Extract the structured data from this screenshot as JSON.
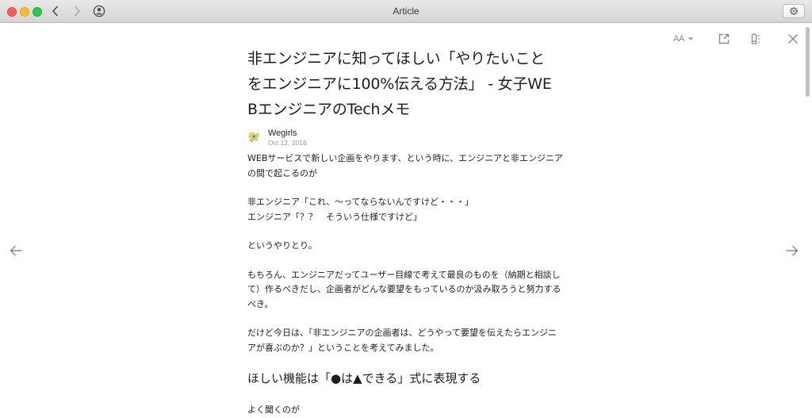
{
  "window": {
    "title": "Article"
  },
  "article": {
    "title": "非エンジニアに知ってほしい「やりたいこと\nをエンジニアに100%伝える方法」 - 女子WE\nBエンジニアのTechメモ",
    "author": "Wegirls",
    "date": "Oct 12, 2016",
    "paragraphs": [
      "WEBサービスで新しい企画をやります、という時に、エンジニアと非エンジニア\nの間で起こるのが",
      "非エンジニア「これ、〜ってならないんですけど・・・」\nエンジニア「？？　そういう仕様ですけど」",
      "というやりとり。",
      "もちろん、エンジニアだってユーザー目線で考えて最良のものを（納期と相談し\nて）作るべきだし、企画者がどんな要望をもっているのか汲み取ろうと努力する\nべき。",
      "だけど今日は、「非エンジニアの企画者は、どうやって要望を伝えたらエンジニ\nアが喜ぶのか？」ということを考えてみました。"
    ],
    "section_heading": "ほしい機能は「●は▲できる」式に表現する",
    "after_heading": "よく聞くのが"
  },
  "toolbar": {
    "font_size_label": "AA"
  },
  "icons": {
    "back": "chevron-left-icon",
    "forward": "chevron-right-icon",
    "user": "user-circle-icon",
    "settings": "gear-icon",
    "font": "text-size-icon",
    "share": "share-icon",
    "markup": "markup-icon",
    "close": "close-icon",
    "prev": "arrow-left-icon",
    "next": "arrow-right-icon"
  },
  "colors": {
    "close": "#fc5f57",
    "minimize": "#fdbc2e",
    "maximize": "#34c84a",
    "text": "#1d1d1d",
    "muted": "#9a9a9a",
    "icon": "#8a8a8a"
  }
}
